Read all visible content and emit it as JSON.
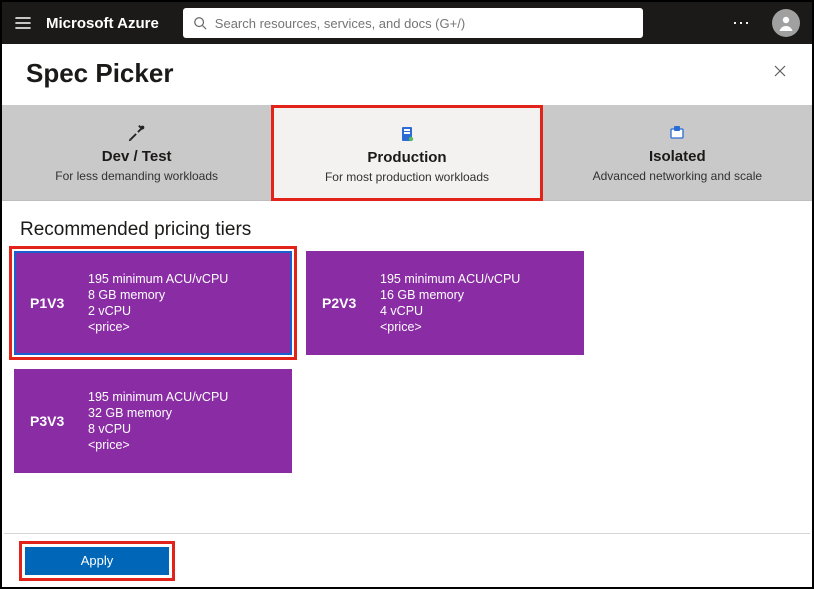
{
  "header": {
    "brand": "Microsoft Azure",
    "search_placeholder": "Search resources, services, and docs (G+/)"
  },
  "blade": {
    "title": "Spec Picker"
  },
  "tabs": [
    {
      "title": "Dev / Test",
      "subtitle": "For less demanding workloads",
      "active": false
    },
    {
      "title": "Production",
      "subtitle": "For most production workloads",
      "active": true
    },
    {
      "title": "Isolated",
      "subtitle": "Advanced networking and scale",
      "active": false
    }
  ],
  "section": {
    "recommended_title": "Recommended pricing tiers"
  },
  "tiers": [
    {
      "sku": "P1V3",
      "acu": "195 minimum ACU/vCPU",
      "memory": "8 GB memory",
      "vcpu": "2 vCPU",
      "price": "<price>",
      "selected": true
    },
    {
      "sku": "P2V3",
      "acu": "195 minimum ACU/vCPU",
      "memory": "16 GB memory",
      "vcpu": "4 vCPU",
      "price": "<price>",
      "selected": false
    },
    {
      "sku": "P3V3",
      "acu": "195 minimum ACU/vCPU",
      "memory": "32 GB memory",
      "vcpu": "8 vCPU",
      "price": "<price>",
      "selected": false
    }
  ],
  "footer": {
    "apply_label": "Apply"
  }
}
